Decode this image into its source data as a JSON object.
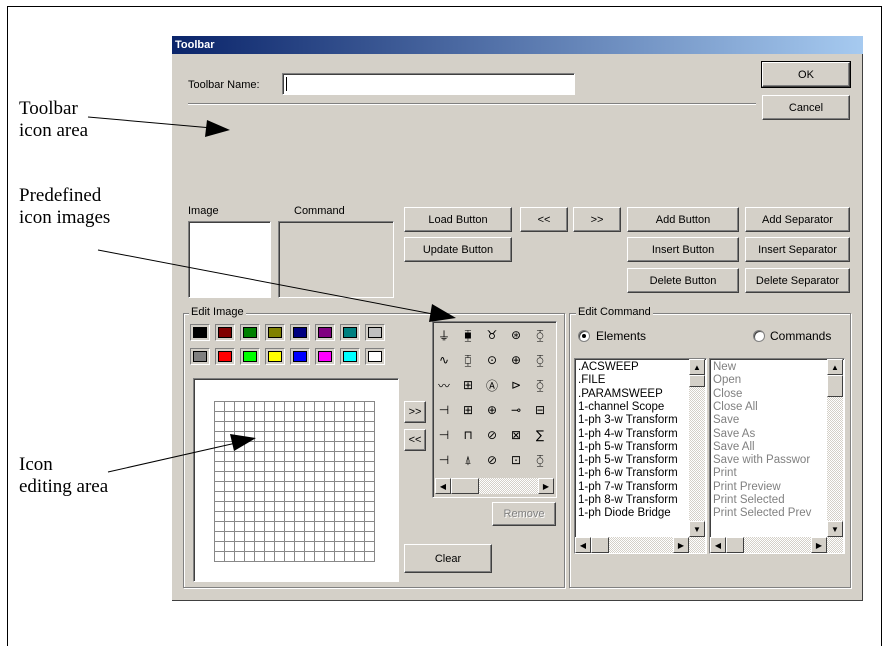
{
  "annotations": {
    "toolbar_icon_area": "Toolbar\nicon area",
    "predefined_icon_images": "Predefined\nicon images",
    "icon_editing_area": "Icon\nediting area"
  },
  "dialog": {
    "title": "Toolbar",
    "toolbar_name_label": "Toolbar Name:",
    "toolbar_name_value": "",
    "ok_label": "OK",
    "cancel_label": "Cancel",
    "image_label": "Image",
    "command_label": "Command",
    "buttons": {
      "load": "Load Button",
      "update": "Update Button",
      "prev": "<<",
      "next": ">>",
      "add": "Add Button",
      "insert": "Insert Button",
      "delete": "Delete Button",
      "add_sep": "Add Separator",
      "insert_sep": "Insert Separator",
      "delete_sep": "Delete Separator",
      "move_right": ">>",
      "move_left": "<<",
      "remove": "Remove",
      "clear": "Clear"
    },
    "edit_image": {
      "title": "Edit Image",
      "colors_row1": [
        "#000000",
        "#800000",
        "#008000",
        "#808000",
        "#000080",
        "#800080",
        "#008080",
        "#c0c0c0"
      ],
      "colors_row2": [
        "#808080",
        "#ff0000",
        "#00ff00",
        "#ffff00",
        "#0000ff",
        "#ff00ff",
        "#00ffff",
        "#ffffff"
      ]
    },
    "icon_images": [
      "⏚",
      "⧯",
      "♉",
      "⊛",
      "⧲",
      "∿",
      "⧮",
      "⊙",
      "⊕",
      "⧲",
      "〰",
      "⊞",
      "Ⓐ",
      "⊳",
      "⧲",
      "⊣",
      "⊞",
      "⊕",
      "⊸",
      "⊟",
      "⊣",
      "⊓",
      "⊘",
      "⊠",
      "∑",
      "⊣",
      "⍋",
      "⊘",
      "⊡",
      "⧲"
    ],
    "edit_command": {
      "title": "Edit Command",
      "radio_elements": "Elements",
      "radio_commands": "Commands",
      "elements_list": [
        ".ACSWEEP",
        ".FILE",
        ".PARAMSWEEP",
        "1-channel Scope",
        "1-ph 3-w Transform",
        "1-ph 4-w Transform",
        "1-ph 5-w Transform",
        "1-ph 5-w Transform",
        "1-ph 6-w Transform",
        "1-ph 7-w Transform",
        "1-ph 8-w Transform",
        "1-ph Diode Bridge"
      ],
      "commands_list": [
        "New",
        "Open",
        "Close",
        "Close All",
        "Save",
        "Save As",
        "Save All",
        "Save with Passwor",
        "Print",
        "Print Preview",
        "Print Selected",
        "Print Selected Prev"
      ]
    }
  }
}
